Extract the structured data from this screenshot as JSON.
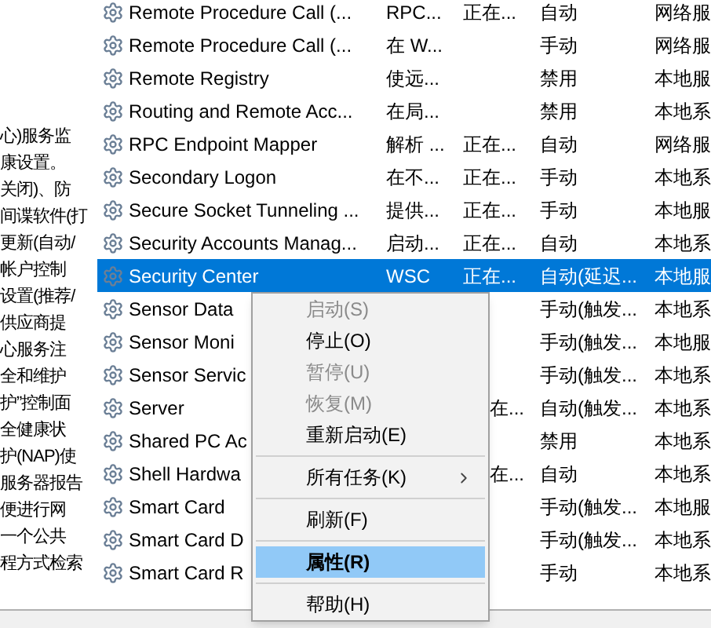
{
  "description_lines": [
    "心)服务监",
    "康设置。",
    "关闭)、防",
    "间谍软件(打",
    "更新(自动/",
    "帐户控制",
    "设置(推荐/",
    "供应商提",
    "心服务注",
    "全和维护",
    "护”控制面",
    "全健康状",
    "护(NAP)使",
    "服务器报告",
    "便进行网",
    "一个公共",
    "程方式检索"
  ],
  "services": [
    {
      "name": "Remote Procedure Call (...",
      "description": "RPC...",
      "status": "正在...",
      "startup": "自动",
      "logon": "网络服",
      "selected": false
    },
    {
      "name": "Remote Procedure Call (...",
      "description": "在 W...",
      "startup": "手动",
      "logon": "网络服",
      "selected": false
    },
    {
      "name": "Remote Registry",
      "description": "使远...",
      "startup": "禁用",
      "logon": "本地服",
      "selected": false
    },
    {
      "name": "Routing and Remote Acc...",
      "description": "在局...",
      "startup": "禁用",
      "logon": "本地系",
      "selected": false
    },
    {
      "name": "RPC Endpoint Mapper",
      "description": "解析 ...",
      "status": "正在...",
      "startup": "自动",
      "logon": "网络服",
      "selected": false
    },
    {
      "name": "Secondary Logon",
      "description": "在不...",
      "status": "正在...",
      "startup": "手动",
      "logon": "本地系",
      "selected": false
    },
    {
      "name": "Secure Socket Tunneling ...",
      "description": "提供...",
      "status": "正在...",
      "startup": "手动",
      "logon": "本地服",
      "selected": false
    },
    {
      "name": "Security Accounts Manag...",
      "description": "启动...",
      "status": "正在...",
      "startup": "自动",
      "logon": "本地系",
      "selected": false
    },
    {
      "name": "Security Center",
      "description": "WSC",
      "status": "正在...",
      "startup": "自动(延迟...",
      "logon": "本地服",
      "selected": true
    },
    {
      "name": "Sensor Data",
      "startup": "手动(触发...",
      "logon": "本地系",
      "selected": false
    },
    {
      "name": "Sensor Moni",
      "startup": "手动(触发...",
      "logon": "本地服",
      "selected": false
    },
    {
      "name": "Sensor Servic",
      "startup": "手动(触发...",
      "logon": "本地系",
      "selected": false
    },
    {
      "name": "Server",
      "status": "在...",
      "startup": "自动(触发...",
      "logon": "本地系",
      "selected": false
    },
    {
      "name": "Shared PC Ac",
      "startup": "禁用",
      "logon": "本地系",
      "selected": false
    },
    {
      "name": "Shell Hardwa",
      "status": "在...",
      "startup": "自动",
      "logon": "本地系",
      "selected": false
    },
    {
      "name": "Smart Card",
      "startup": "手动(触发...",
      "logon": "本地服",
      "selected": false
    },
    {
      "name": "Smart Card D",
      "startup": "手动(触发...",
      "logon": "本地系",
      "selected": false
    },
    {
      "name": "Smart Card R",
      "startup": "手动",
      "logon": "本地系",
      "selected": false
    }
  ],
  "context_menu": [
    {
      "kind": "item",
      "label": "启动(S)",
      "disabled": true,
      "selected": false
    },
    {
      "kind": "item",
      "label": "停止(O)",
      "disabled": false,
      "selected": false
    },
    {
      "kind": "item",
      "label": "暂停(U)",
      "disabled": true,
      "selected": false
    },
    {
      "kind": "item",
      "label": "恢复(M)",
      "disabled": true,
      "selected": false
    },
    {
      "kind": "item",
      "label": "重新启动(E)",
      "disabled": false,
      "selected": false
    },
    {
      "kind": "separator"
    },
    {
      "kind": "submenu",
      "label": "所有任务(K)",
      "disabled": false,
      "selected": false
    },
    {
      "kind": "separator"
    },
    {
      "kind": "item",
      "label": "刷新(F)",
      "disabled": false,
      "selected": false
    },
    {
      "kind": "separator"
    },
    {
      "kind": "default",
      "label": "属性(R)",
      "disabled": false,
      "selected": true
    },
    {
      "kind": "separator"
    },
    {
      "kind": "item",
      "label": "帮助(H)",
      "disabled": false,
      "selected": false
    }
  ]
}
